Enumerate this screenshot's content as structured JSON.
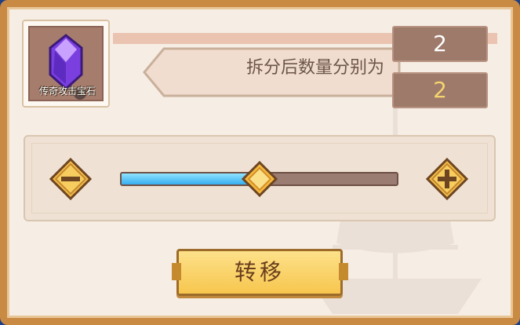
{
  "item": {
    "name": "传奇攻击宝石",
    "icon": "purple-gem-icon",
    "color": "#7b3fe0"
  },
  "split": {
    "label": "拆分后数量分别为",
    "count_a": "2",
    "count_b": "2"
  },
  "slider": {
    "value_fraction": 0.5,
    "minus_label": "−",
    "plus_label": "+"
  },
  "transfer_button": "转移",
  "colors": {
    "frame": "#c98a43",
    "panel": "#f6ede4",
    "button": "#f7c64e",
    "fill": "#36aef0"
  }
}
